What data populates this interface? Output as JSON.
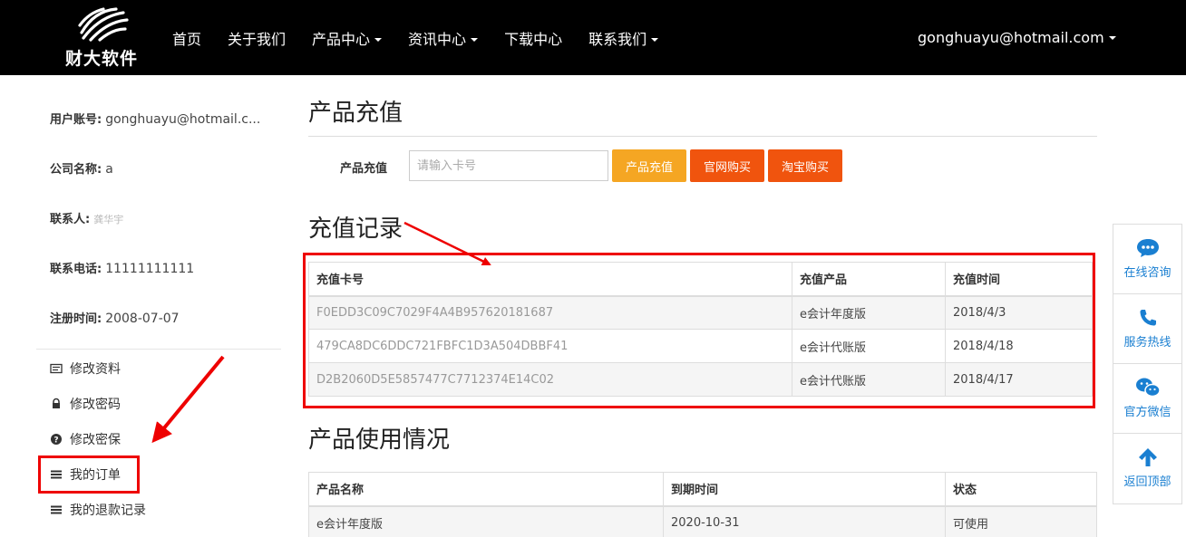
{
  "nav": {
    "logo_text": "财大软件",
    "items": [
      "首页",
      "关于我们",
      "产品中心",
      "资讯中心",
      "下载中心",
      "联系我们"
    ],
    "user": "gonghuayu@hotmail.com"
  },
  "sidebar": {
    "info": [
      {
        "label": "用户账号:",
        "value": "gonghuayu@hotmail.c..."
      },
      {
        "label": "公司名称:",
        "value": "a"
      },
      {
        "label": "联系人:",
        "value": "龚华宇"
      },
      {
        "label": "联系电话:",
        "value": "11111111111"
      },
      {
        "label": "注册时间:",
        "value": "2008-07-07"
      }
    ],
    "menu": [
      "修改资料",
      "修改密码",
      "修改密保",
      "我的订单",
      "我的退款记录"
    ]
  },
  "recharge": {
    "title": "产品充值",
    "label": "产品充值",
    "placeholder": "请输入卡号",
    "btn_recharge": "产品充值",
    "btn_official": "官网购买",
    "btn_taobao": "淘宝购买"
  },
  "records": {
    "title": "充值记录",
    "headers": [
      "充值卡号",
      "充值产品",
      "充值时间"
    ],
    "rows": [
      [
        "F0EDD3C09C7029F4A4B957620181687",
        "e会计年度版",
        "2018/4/3"
      ],
      [
        "479CA8DC6DDC721FBFC1D3A504DBBF41",
        "e会计代账版",
        "2018/4/18"
      ],
      [
        "D2B2060D5E5857477C7712374E14C02",
        "e会计代账版",
        "2018/4/17"
      ]
    ]
  },
  "usage": {
    "title": "产品使用情况",
    "headers": [
      "产品名称",
      "到期时间",
      "状态"
    ],
    "rows": [
      [
        "e会计年度版",
        "2020-10-31",
        "可使用"
      ]
    ]
  },
  "float_bar": [
    "在线咨询",
    "服务热线",
    "官方微信",
    "返回顶部"
  ],
  "colors": {
    "nav_bg": "#000000",
    "btn_recharge": "#f5a623",
    "btn_buy": "#f0540e",
    "float_accent": "#1a7fd1",
    "highlight_red": "#e00000"
  }
}
